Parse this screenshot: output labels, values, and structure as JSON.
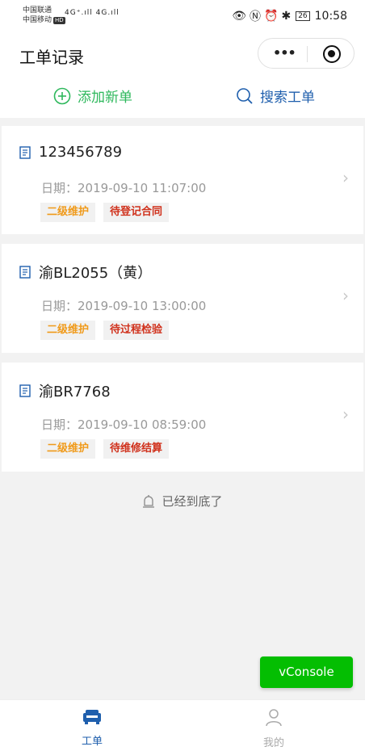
{
  "status_bar": {
    "carrier1": "中国联通",
    "carrier2": "中国移动",
    "hd": "HD",
    "signal": "4G⁺.ıll 4G.ıll",
    "battery": "26",
    "time": "10:58"
  },
  "nav": {
    "title": "工单记录"
  },
  "actions": {
    "add_label": "添加新单",
    "search_label": "搜索工单"
  },
  "orders": [
    {
      "id": "123456789",
      "date_label": "日期：",
      "date": "2019-09-10 11:07:00",
      "level": "二级维护",
      "status": "待登记合同"
    },
    {
      "id": "渝BL2055（黄）",
      "date_label": "日期：",
      "date": "2019-09-10 13:00:00",
      "level": "二级维护",
      "status": "待过程检验"
    },
    {
      "id": "渝BR7768",
      "date_label": "日期：",
      "date": "2019-09-10 08:59:00",
      "level": "二级维护",
      "status": "待维修结算"
    }
  ],
  "end_message": "已经到底了",
  "vconsole_label": "vConsole",
  "tabs": [
    {
      "label": "工单",
      "icon": "car-icon",
      "active": true
    },
    {
      "label": "我的",
      "icon": "user-icon",
      "active": false
    }
  ],
  "colors": {
    "green": "#2eb85c",
    "blue": "#1f5fad",
    "orange": "#f09a1a",
    "red": "#d0311c",
    "vconsole": "#04be02"
  }
}
